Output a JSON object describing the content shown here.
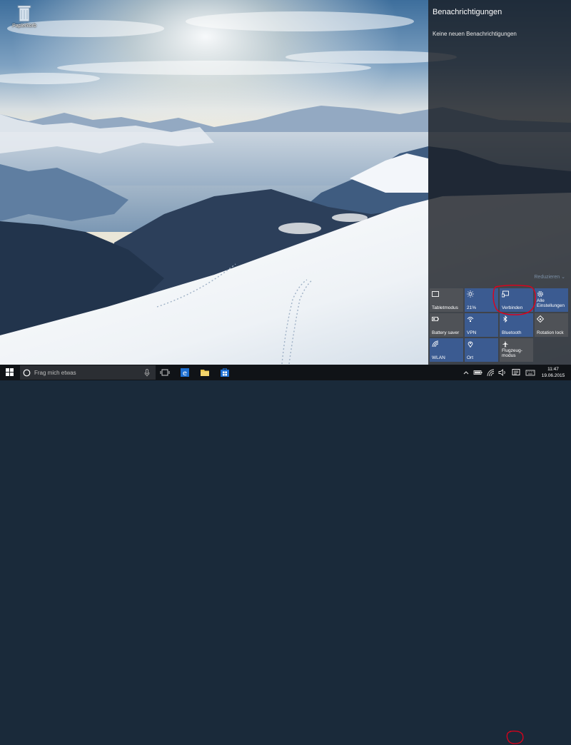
{
  "desktop": {
    "icons": [
      {
        "label": "Papierkorb",
        "icon": "recycle-bin-icon"
      }
    ]
  },
  "action_center": {
    "title": "Benachrichtigungen",
    "empty_message": "Keine neuen Benachrichtigungen",
    "collapse_label": "Reduzieren ⌄",
    "tiles": [
      {
        "label": "Tabletmodus",
        "icon": "tablet-mode-icon",
        "active": false
      },
      {
        "label": "21%",
        "icon": "brightness-icon",
        "active": true
      },
      {
        "label": "Verbinden",
        "icon": "connect-icon",
        "active": true
      },
      {
        "label": "Alle Einstellungen",
        "icon": "settings-icon",
        "active": true
      },
      {
        "label": "Battery saver",
        "icon": "battery-saver-icon",
        "active": false
      },
      {
        "label": "VPN",
        "icon": "vpn-icon",
        "active": true
      },
      {
        "label": "Bluetooth",
        "icon": "bluetooth-icon",
        "active": true
      },
      {
        "label": "Rotation lock",
        "icon": "rotation-lock-icon",
        "active": false
      },
      {
        "label": "WLAN",
        "icon": "wlan-icon",
        "active": true
      },
      {
        "label": "Ort",
        "icon": "location-icon",
        "active": true
      },
      {
        "label": "Flugzeug-modus",
        "icon": "airplane-mode-icon",
        "active": false
      }
    ],
    "accent_color": "#3b5b91",
    "inactive_color": "#4f5257",
    "annotation_color": "#e0001b"
  },
  "taskbar": {
    "search_placeholder": "Frag mich etwas",
    "pinned": [
      {
        "icon": "task-view-icon"
      },
      {
        "icon": "ie-icon"
      },
      {
        "icon": "file-explorer-icon"
      },
      {
        "icon": "store-icon"
      }
    ],
    "tray": [
      "chevron-up-icon",
      "battery-icon",
      "network-icon",
      "volume-icon",
      "action-center-icon",
      "keyboard-icon"
    ],
    "clock": {
      "time": "11:47",
      "date": "19.06.2015"
    }
  }
}
